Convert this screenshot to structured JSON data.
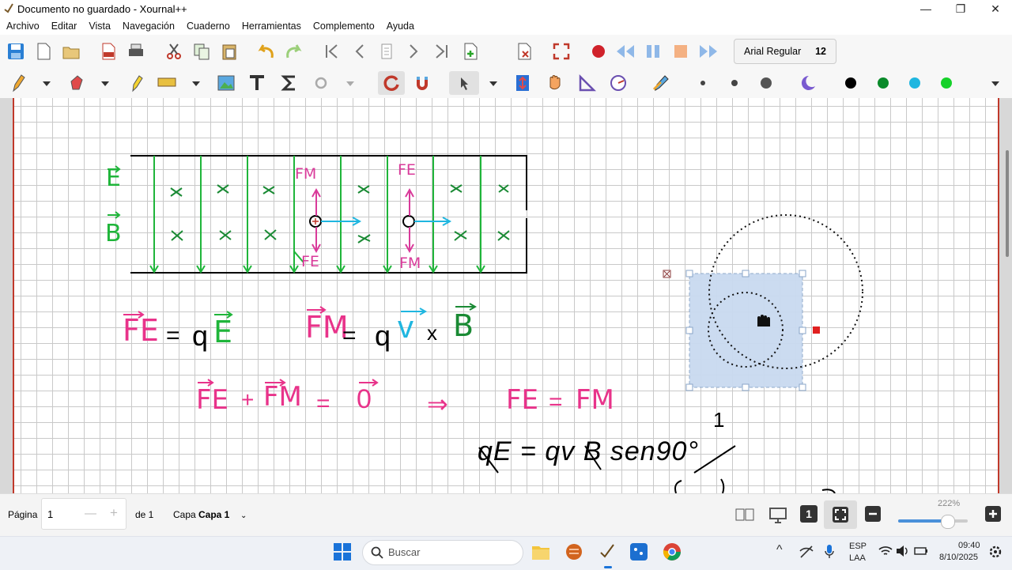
{
  "window": {
    "title": "Documento no guardado - Xournal++"
  },
  "menu": [
    "Archivo",
    "Editar",
    "Vista",
    "Navegación",
    "Cuaderno",
    "Herramientas",
    "Complemento",
    "Ayuda"
  ],
  "toolbar": {
    "font_name": "Arial Regular",
    "font_size": "12"
  },
  "colors": {
    "accent": "#e8338a",
    "green": "#1fb53a",
    "cyan": "#1fb6e0",
    "selection": "#c9daf0",
    "page_border": "#c0392b"
  },
  "drawing": {
    "field_E": "E",
    "field_B": "B",
    "label_FM1": "FM",
    "label_FE1": "FE",
    "label_FE2": "FE",
    "label_FM2": "FM",
    "eq1_lhs": "FE",
    "eq1_eq": "=",
    "eq1_q": "q",
    "eq1_E": "E",
    "eq2_lhs": "FM",
    "eq2_eq": "=",
    "eq2_q": "q",
    "eq2_v": "v",
    "eq2_x": "x",
    "eq2_B": "B",
    "eq3_a": "FE",
    "eq3_plus": "+",
    "eq3_b": "FM",
    "eq3_eq": "=",
    "eq3_zero": "0",
    "eq3_implies": "⇒",
    "eq3_c": "FE",
    "eq3_eq2": "=",
    "eq3_d": "FM",
    "eq4": "qE = qv B sen90°",
    "eq4_one": "1"
  },
  "status": {
    "page_label": "Página",
    "page_value": "1",
    "page_of": "de 1",
    "layer_label": "Capa",
    "layer_value": "Capa 1",
    "zoom": "222%"
  },
  "taskbar": {
    "search_placeholder": "Buscar",
    "lang": "ESP",
    "lang2": "LAA",
    "time": "09:40",
    "date": "8/10/2025"
  }
}
